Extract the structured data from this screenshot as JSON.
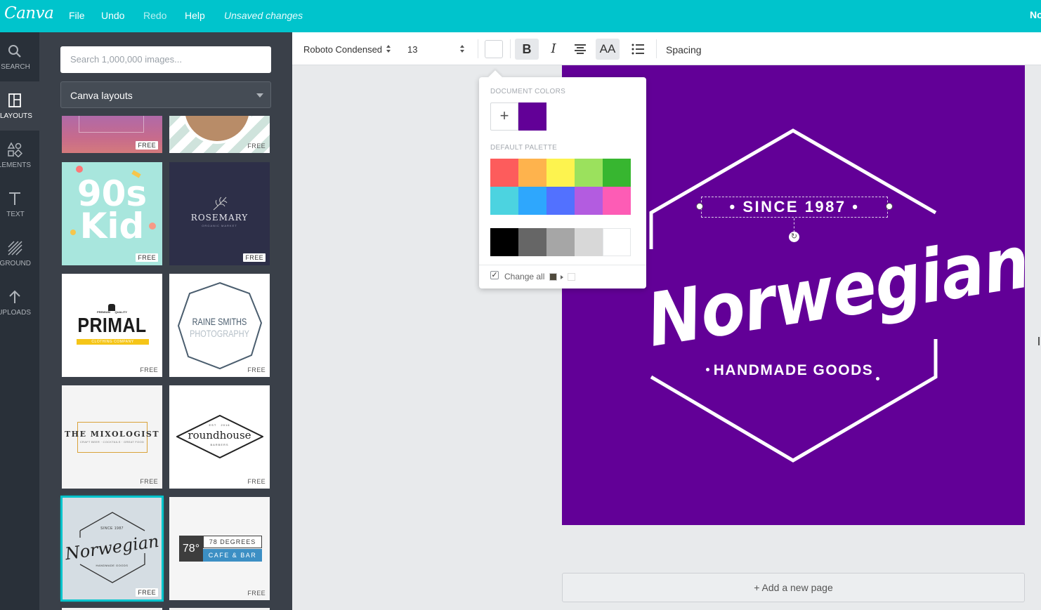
{
  "topbar": {
    "logo": "Canva",
    "menu": [
      "File",
      "Undo",
      "Redo",
      "Help"
    ],
    "unsaved": "Unsaved changes",
    "right_cut": "No"
  },
  "rail": {
    "items": [
      {
        "label": "SEARCH",
        "icon": "search-icon"
      },
      {
        "label": "LAYOUTS",
        "icon": "layouts-icon"
      },
      {
        "label": "ELEMENTS",
        "icon": "shapes-icon"
      },
      {
        "label": "TEXT",
        "icon": "text-icon"
      },
      {
        "label": "BKGROUND",
        "icon": "background-icon"
      },
      {
        "label": "UPLOADS",
        "icon": "upload-icon"
      }
    ]
  },
  "panel": {
    "search_placeholder": "Search 1,000,000 images...",
    "select_value": "Canva layouts",
    "free_label": "FREE",
    "thumbs": {
      "kid": [
        "90s",
        "Kid"
      ],
      "rosemary": {
        "title": "ROSEMARY",
        "sub": "ORGANIC MARKET"
      },
      "primal": {
        "top": "PREMIUM      QUALITY",
        "title": "PRIMAL",
        "band": "CLOTHING COMPANY"
      },
      "raine": [
        "RAINE SMITHS",
        "PHOTOGRAPHY"
      ],
      "mixologist": {
        "title": "THE MIXOLOGIST",
        "sub": "CRAFT BEER · COCKTAILS · GREAT FOOD"
      },
      "roundhouse": {
        "est": "EST   2016",
        "title": "roundhouse",
        "sub": "BARBERS"
      },
      "norwegian": {
        "since": "SINCE 1987",
        "title": "Norwegian",
        "sub": "HANDMADE GOODS"
      },
      "degrees": {
        "num": "78°",
        "line1": "78 DEGREES",
        "line2": "CAFE & BAR"
      }
    }
  },
  "toolbar": {
    "font_name": "Roboto Condensed",
    "font_size": "13",
    "bold": "B",
    "italic": "I",
    "caps": "AA",
    "spacing": "Spacing"
  },
  "popover": {
    "doc_colors_label": "DOCUMENT COLORS",
    "default_palette_label": "DEFAULT PALETTE",
    "add": "+",
    "change_all": "Change all",
    "doc_colors": [
      "#620097"
    ],
    "palette": [
      "#fd5c5c",
      "#feb34d",
      "#fdf34f",
      "#9be15d",
      "#37b630",
      "#4cd3e0",
      "#2ea7fd",
      "#5271ff",
      "#b35ce0",
      "#fd5cb5"
    ],
    "grays": [
      "#000000",
      "#666666",
      "#a6a6a6",
      "#d8d8d8",
      "#ffffff"
    ]
  },
  "design": {
    "since": "• SINCE 1987 •",
    "title": "Norwegian",
    "handmade": "HANDMADE GOODS",
    "bg": "#620097"
  },
  "add_page": "+ Add a new page"
}
